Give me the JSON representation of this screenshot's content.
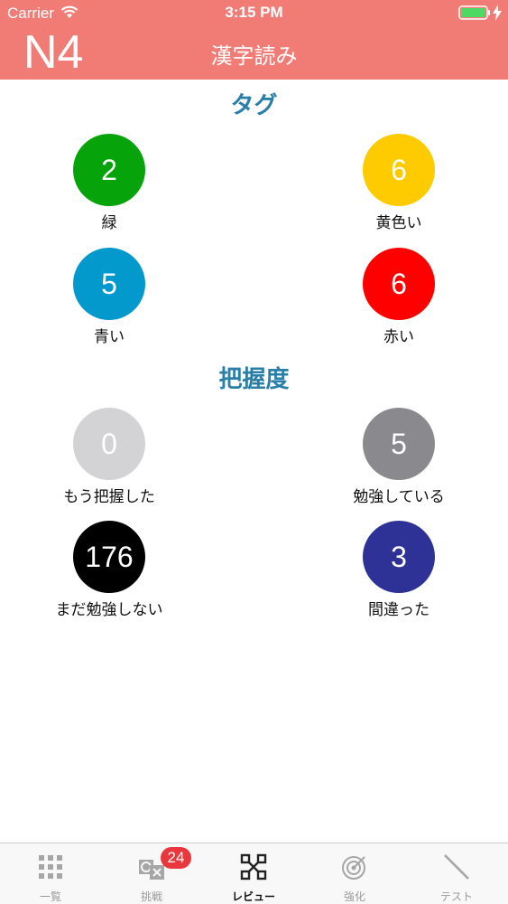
{
  "status_bar": {
    "carrier": "Carrier",
    "time": "3:15 PM"
  },
  "header": {
    "level": "N4",
    "title": "漢字読み",
    "background_color": "#f17c76"
  },
  "tags_section": {
    "title": "タグ",
    "items": [
      {
        "count": "2",
        "label": "緑",
        "color": "#07a30a"
      },
      {
        "count": "6",
        "label": "黄色い",
        "color": "#fecb00"
      },
      {
        "count": "5",
        "label": "青い",
        "color": "#0399cc"
      },
      {
        "count": "6",
        "label": "赤い",
        "color": "#fe0000"
      }
    ]
  },
  "mastery_section": {
    "title": "把握度",
    "items": [
      {
        "count": "0",
        "label": "もう把握した",
        "color": "#d3d3d6"
      },
      {
        "count": "5",
        "label": "勉強している",
        "color": "#8a8a8e"
      },
      {
        "count": "176",
        "label": "まだ勉強しない",
        "color": "#000000"
      },
      {
        "count": "3",
        "label": "間違った",
        "color": "#2e3195"
      }
    ]
  },
  "tab_bar": {
    "tabs": [
      {
        "label": "一覧",
        "icon": "grid-icon",
        "active": false
      },
      {
        "label": "挑戦",
        "icon": "challenge-icon",
        "active": false,
        "badge": "24"
      },
      {
        "label": "レビュー",
        "icon": "review-icon",
        "active": true
      },
      {
        "label": "強化",
        "icon": "target-icon",
        "active": false
      },
      {
        "label": "テスト",
        "icon": "pencil-icon",
        "active": false
      }
    ]
  }
}
